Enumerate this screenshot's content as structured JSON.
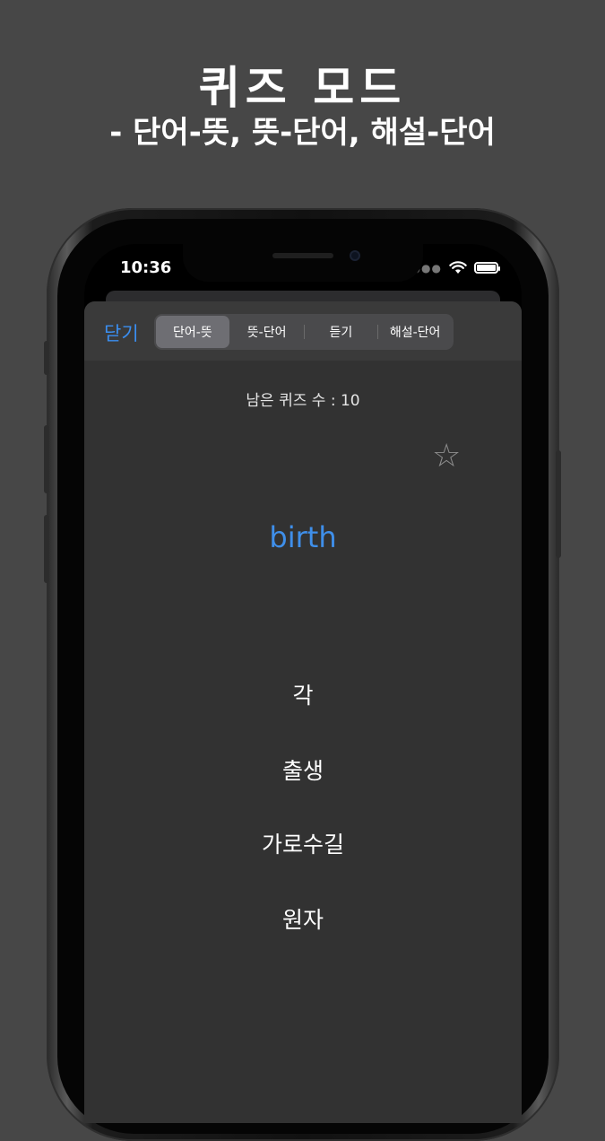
{
  "promo": {
    "title": "퀴즈 모드",
    "subtitle": "- 단어-뜻, 뜻-단어, 해설-단어"
  },
  "status_bar": {
    "time": "10:36"
  },
  "nav": {
    "close_label": "닫기",
    "tabs": [
      {
        "label": "단어-뜻",
        "selected": true
      },
      {
        "label": "뜻-단어",
        "selected": false
      },
      {
        "label": "듣기",
        "selected": false
      },
      {
        "label": "해설-단어",
        "selected": false
      }
    ]
  },
  "quiz": {
    "remaining_text": "남은 퀴즈 수 : 10",
    "favorite_icon": "star-outline-icon",
    "word": "birth",
    "options": [
      "각",
      "출생",
      "가로수길",
      "원자"
    ]
  },
  "colors": {
    "background": "#474747",
    "accent": "#3a8ef0",
    "sheet": "#323232",
    "nav_bar": "#3a3a3a"
  }
}
